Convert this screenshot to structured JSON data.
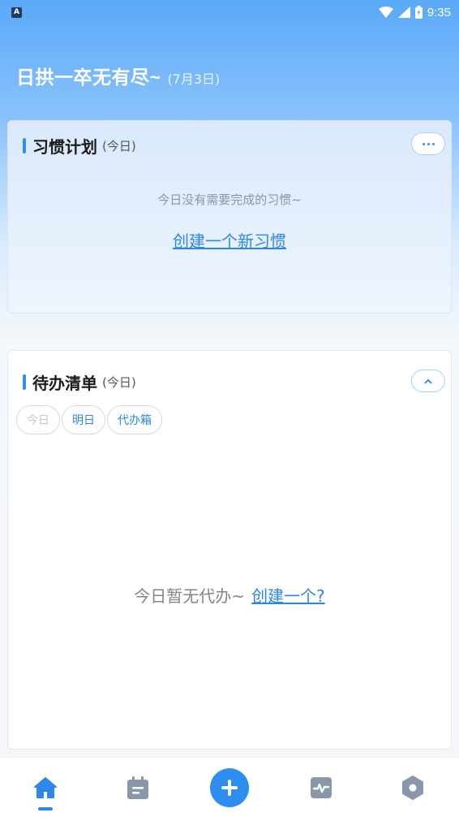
{
  "status_bar": {
    "notification_icon_letter": "A",
    "time": "9:35",
    "icons": [
      "wifi-icon",
      "signal-icon",
      "battery-icon"
    ]
  },
  "header": {
    "title": "日拱一卒无有尽~",
    "date": "(7月3日)"
  },
  "habit_card": {
    "title": "习惯计划",
    "subtitle": "(今日)",
    "more_icon": "more-dots-icon",
    "empty_text": "今日没有需要完成的习惯~",
    "create_link": "创建一个新习惯"
  },
  "todo_card": {
    "title": "待办清单",
    "subtitle": "(今日)",
    "collapse_icon": "chevron-up-icon",
    "tabs": [
      {
        "label": "今日",
        "state": "disabled"
      },
      {
        "label": "明日",
        "state": "active"
      },
      {
        "label": "代办箱",
        "state": "active"
      }
    ],
    "empty_text": "今日暂无代办~",
    "create_link": "创建一个?"
  },
  "bottom_nav": {
    "items": [
      {
        "icon": "home-icon",
        "selected": true
      },
      {
        "icon": "calendar-list-icon",
        "selected": false
      },
      {
        "icon": "add-icon",
        "selected": false
      },
      {
        "icon": "activity-icon",
        "selected": false
      },
      {
        "icon": "settings-hexagon-icon",
        "selected": false
      }
    ]
  },
  "colors": {
    "accent": "#2d87e8",
    "header_gradient_top": "#5aa9f8",
    "muted_text": "#8d95a0"
  }
}
